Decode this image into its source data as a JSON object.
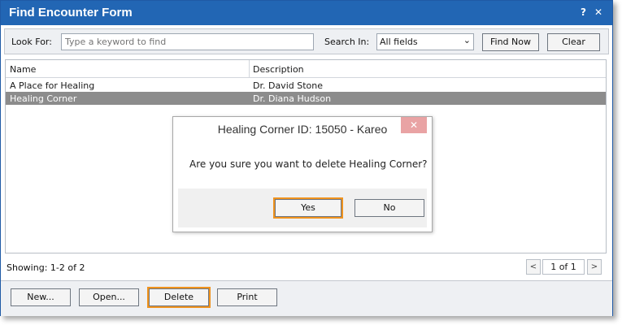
{
  "window": {
    "title": "Find Encounter Form",
    "help_glyph": "?",
    "close_glyph": "✕"
  },
  "search": {
    "look_for_label": "Look For:",
    "placeholder": "Type a keyword to find",
    "search_in_label": "Search In:",
    "search_in_value": "All fields",
    "find_now_label": "Find Now",
    "clear_label": "Clear"
  },
  "grid": {
    "columns": [
      "Name",
      "Description"
    ],
    "rows": [
      {
        "name": "A Place for Healing",
        "description": "Dr. David Stone",
        "selected": false
      },
      {
        "name": "Healing Corner",
        "description": "Dr. Diana Hudson",
        "selected": true
      }
    ]
  },
  "status": {
    "showing": "Showing: 1-2 of 2",
    "page": "1 of 1",
    "prev_glyph": "<",
    "next_glyph": ">"
  },
  "footer": {
    "new_label": "New...",
    "open_label": "Open...",
    "delete_label": "Delete",
    "print_label": "Print"
  },
  "dialog": {
    "title": "Healing Corner ID: 15050 - Kareo",
    "close_glyph": "✕",
    "message": "Are you sure you want to delete Healing Corner?",
    "yes_label": "Yes",
    "no_label": "No"
  },
  "colors": {
    "titlebar": "#2266b4",
    "highlight": "#f0931e",
    "selected_row": "#8c8c8c"
  }
}
